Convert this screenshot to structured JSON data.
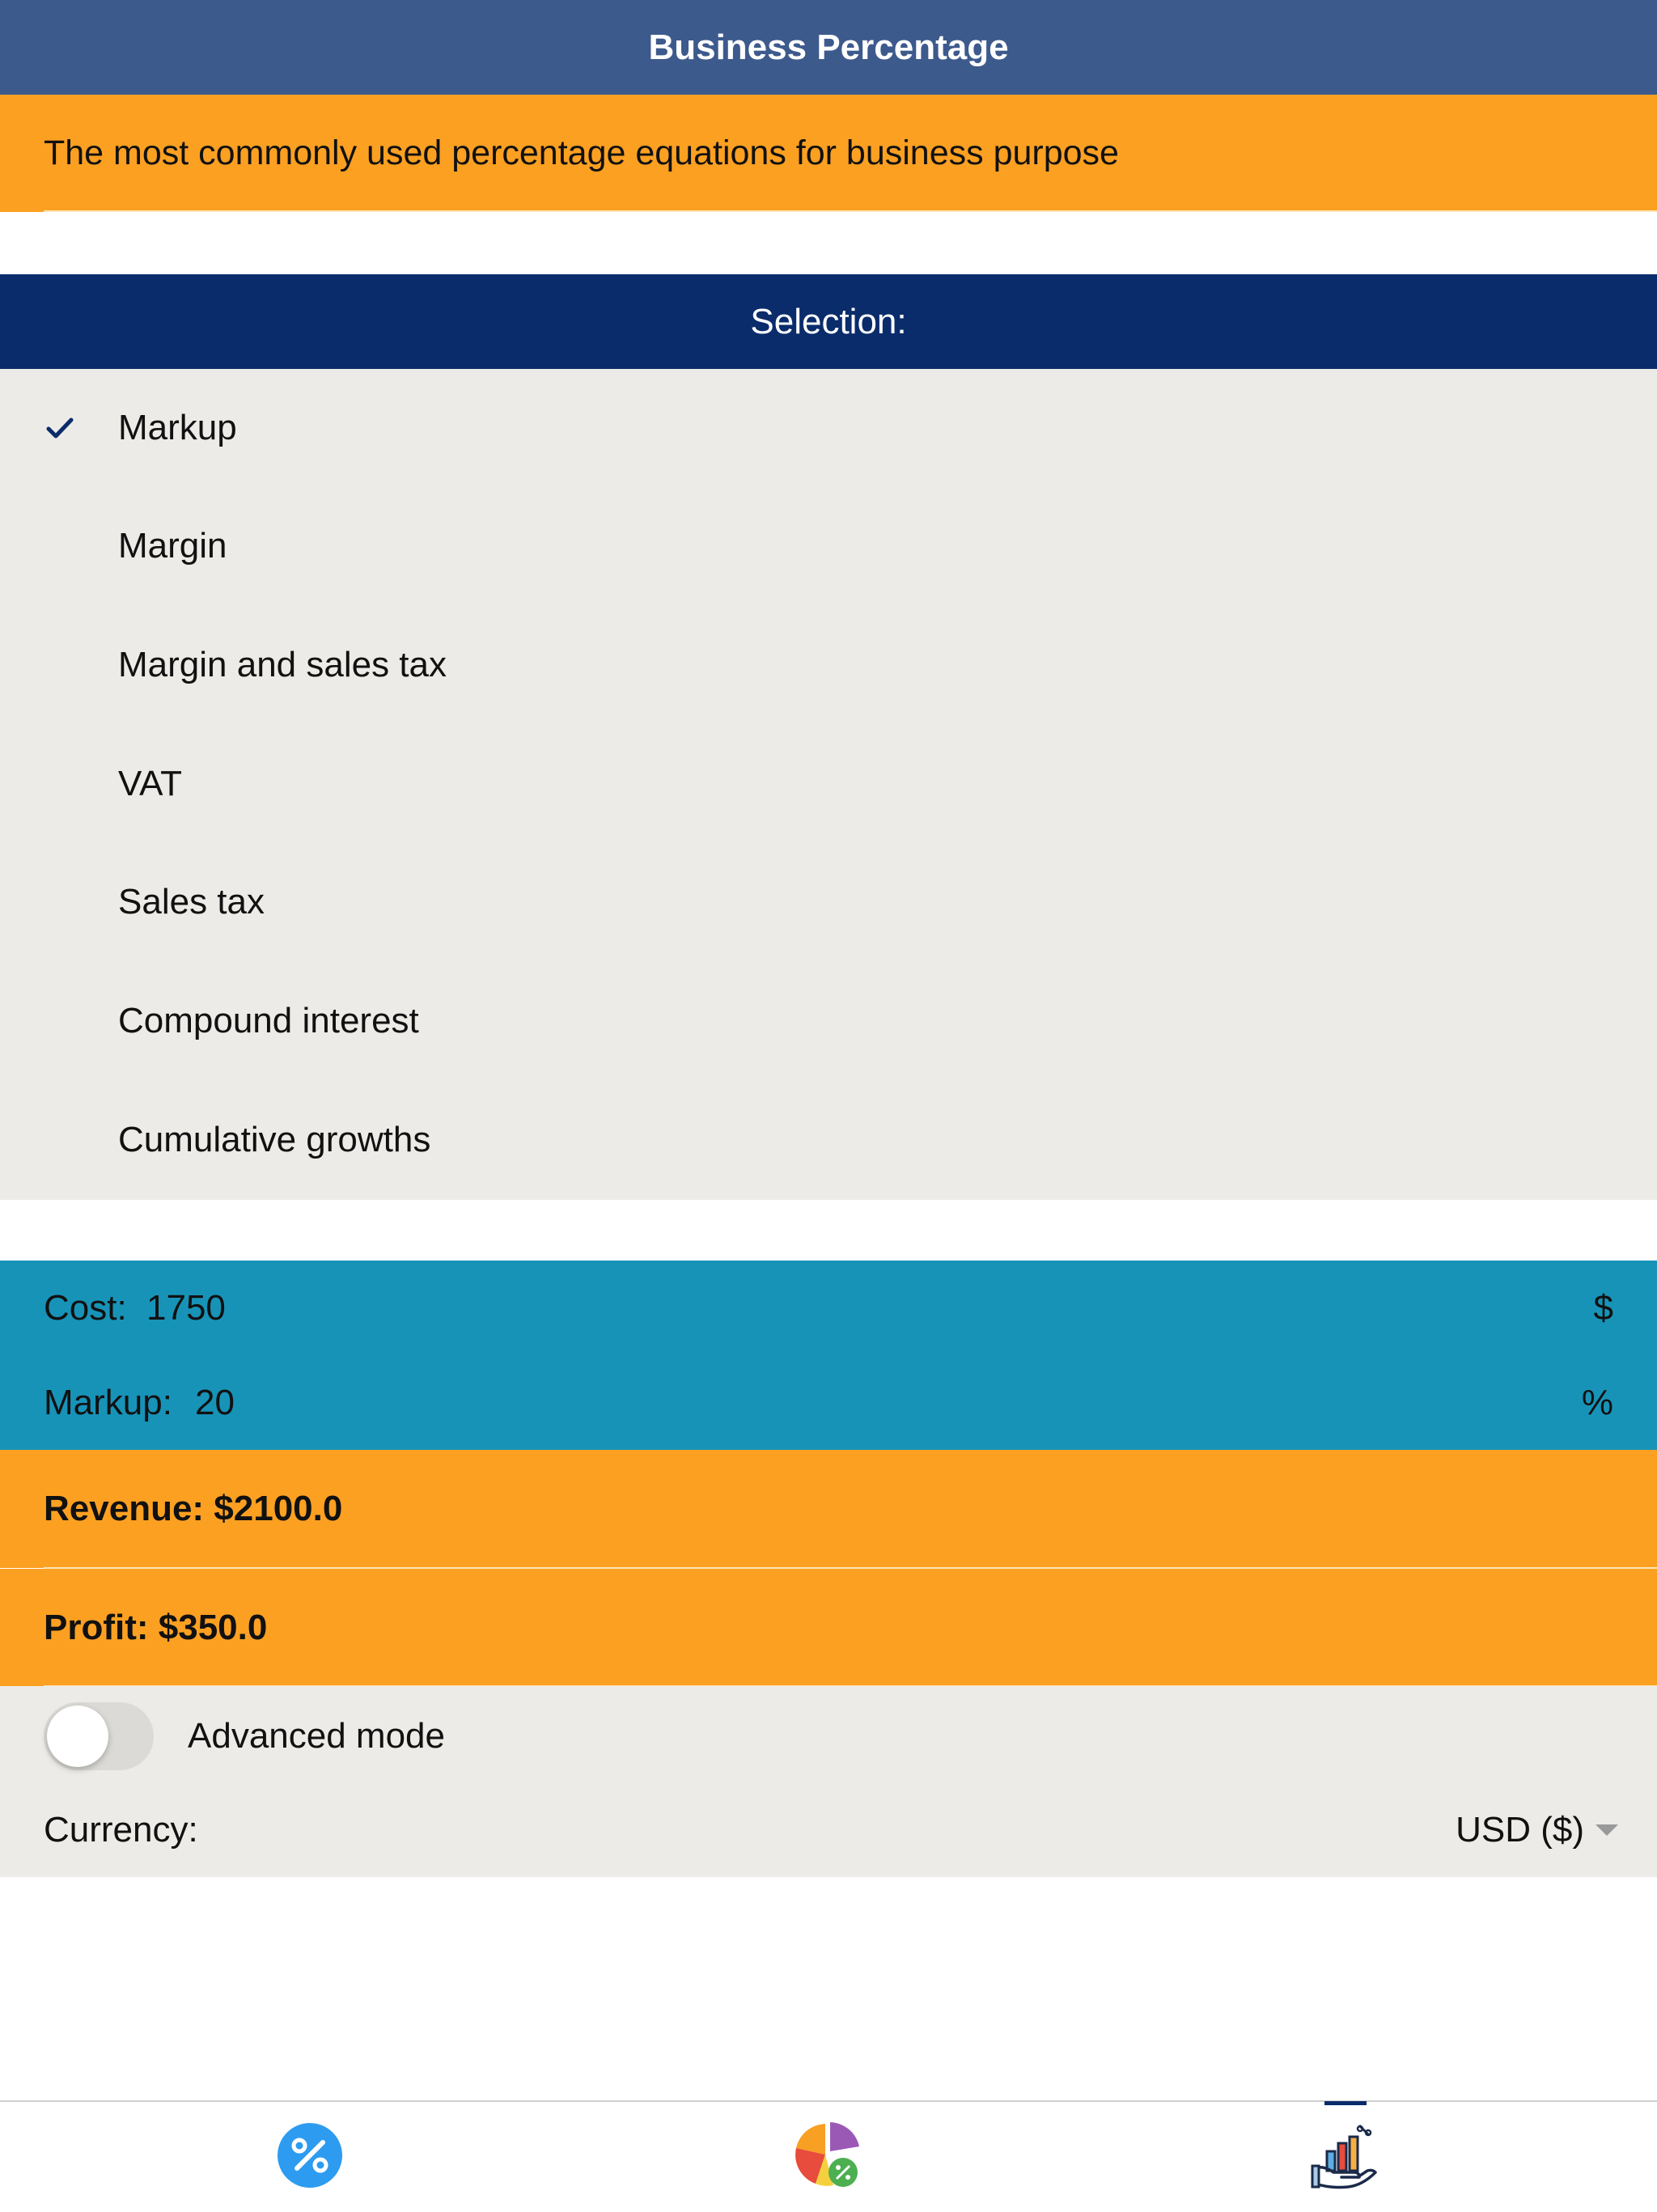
{
  "header": {
    "title": "Business Percentage"
  },
  "subtitle": "The most commonly used percentage equations for business purpose",
  "selection": {
    "title": "Selection:",
    "options": [
      {
        "label": "Markup",
        "selected": true
      },
      {
        "label": "Margin",
        "selected": false
      },
      {
        "label": "Margin and sales tax",
        "selected": false
      },
      {
        "label": "VAT",
        "selected": false
      },
      {
        "label": "Sales tax",
        "selected": false
      },
      {
        "label": "Compound interest",
        "selected": false
      },
      {
        "label": "Cumulative growths",
        "selected": false
      }
    ]
  },
  "inputs": {
    "cost": {
      "label": "Cost:",
      "value": "1750",
      "unit": "$"
    },
    "markup": {
      "label": "Markup:",
      "value": "20",
      "unit": "%"
    }
  },
  "results": {
    "revenue": "Revenue: $2100.0",
    "profit": "Profit: $350.0"
  },
  "settings": {
    "advanced_mode_label": "Advanced mode",
    "advanced_mode_on": false,
    "currency_label": "Currency:",
    "currency_value": "USD ($)"
  },
  "tabbar": {
    "tabs": [
      {
        "icon": "percent-icon",
        "active": false
      },
      {
        "icon": "pie-chart-percent-icon",
        "active": false
      },
      {
        "icon": "business-chart-hand-icon",
        "active": true
      }
    ]
  },
  "colors": {
    "header": "#3d5a8d",
    "accent_orange": "#fca022",
    "selection_header": "#0a2c6b",
    "inputs_bg": "#1893b8",
    "list_bg": "#edebe7"
  }
}
